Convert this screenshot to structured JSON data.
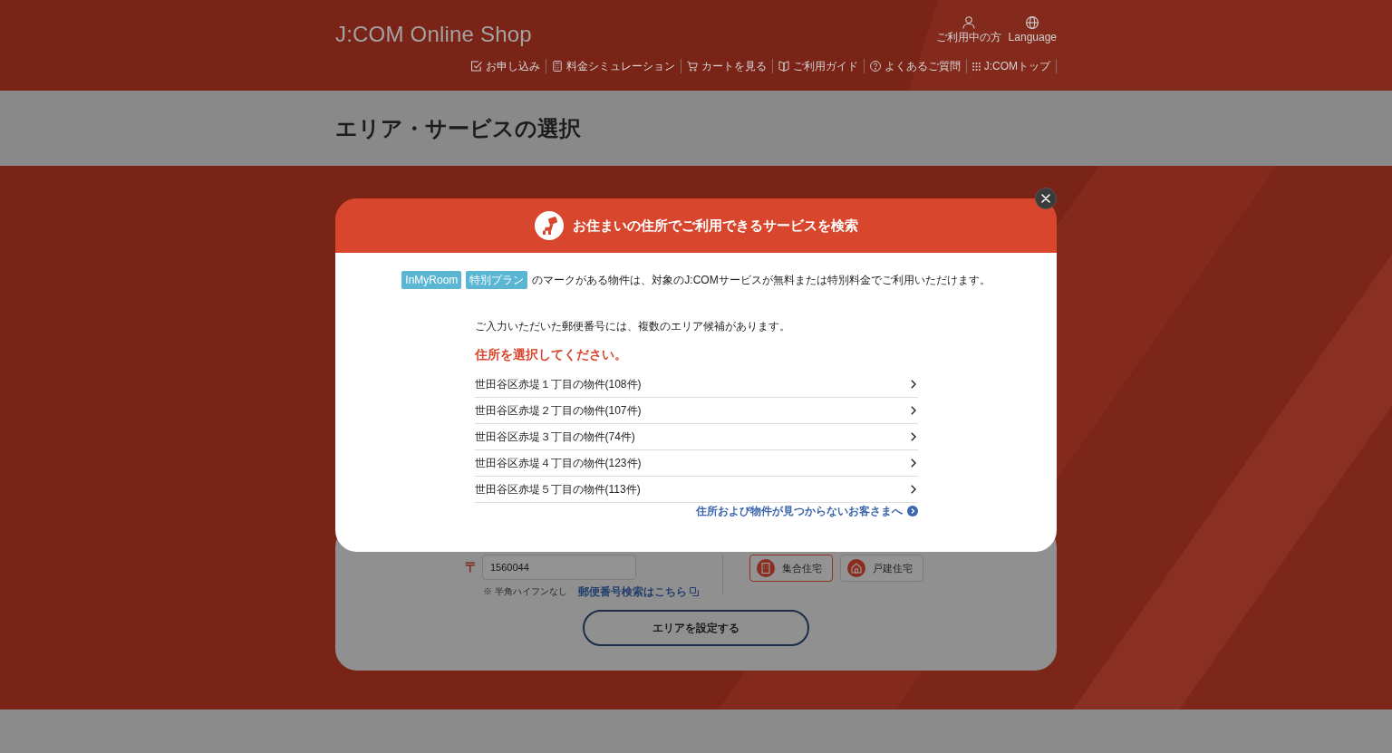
{
  "header": {
    "logo": "J:COM Online Shop",
    "utility_links": [
      {
        "label": "ご利用中の方",
        "kind": "user"
      },
      {
        "label": "Language",
        "kind": "globe"
      }
    ],
    "nav": [
      {
        "label": "お申し込み",
        "kind": "check"
      },
      {
        "label": "料金シミュレーション",
        "kind": "calculator"
      },
      {
        "label": "カートを見る",
        "kind": "cart"
      },
      {
        "label": "ご利用ガイド",
        "kind": "book"
      },
      {
        "label": "よくあるご質問",
        "kind": "question"
      },
      {
        "label": "J:COMトップ",
        "kind": "grid"
      }
    ]
  },
  "page_title": "エリア・サービスの選択",
  "area_form": {
    "postal_mark": "〒",
    "postal_code": "1560044",
    "note": "※ 半角ハイフンなし",
    "postal_search_link": "郵便番号検索はこちら",
    "housing_types": [
      {
        "label": "集合住宅",
        "kind": "apartment",
        "selected": true
      },
      {
        "label": "戸建住宅",
        "kind": "house",
        "selected": false
      }
    ],
    "submit": "エリアを設定する"
  },
  "modal": {
    "title": "お住まいの住所でご利用できるサービスを検索",
    "tags": [
      "InMyRoom",
      "特別プラン"
    ],
    "tag_note": "のマークがある物件は、対象のJ:COMサービスが無料または特別料金でご利用いただけます。",
    "message": "ご入力いただいた郵便番号には、複数のエリア候補があります。",
    "prompt": "住所を選択してください。",
    "addresses": [
      "世田谷区赤堤１丁目の物件(108件)",
      "世田谷区赤堤２丁目の物件(107件)",
      "世田谷区赤堤３丁目の物件(74件)",
      "世田谷区赤堤４丁目の物件(123件)",
      "世田谷区赤堤５丁目の物件(113件)"
    ],
    "help_link": "住所および物件が見つからないお客さまへ"
  }
}
